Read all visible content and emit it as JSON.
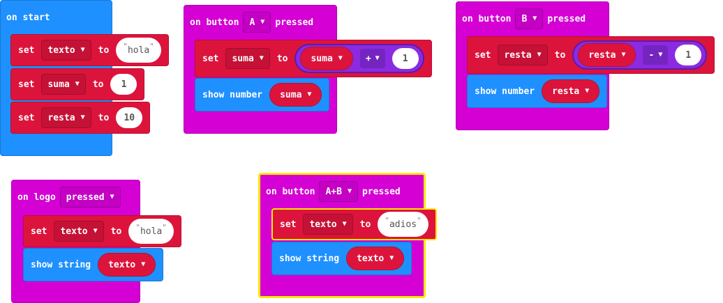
{
  "on_start": {
    "title": "on start",
    "set_label": "set",
    "to_label": "to",
    "rows": [
      {
        "var": "texto",
        "value": "hola"
      },
      {
        "var": "suma",
        "value": "1"
      },
      {
        "var": "resta",
        "value": "10"
      }
    ]
  },
  "button_a": {
    "on_button": "on button",
    "button": "A",
    "pressed": "pressed",
    "set_label": "set",
    "var": "suma",
    "to_label": "to",
    "operand_var": "suma",
    "operator": "+",
    "operand_value": "1",
    "show_label": "show number",
    "show_var": "suma"
  },
  "button_b": {
    "on_button": "on button",
    "button": "B",
    "pressed": "pressed",
    "set_label": "set",
    "var": "resta",
    "to_label": "to",
    "operand_var": "resta",
    "operator": "-",
    "operand_value": "1",
    "show_label": "show number",
    "show_var": "resta"
  },
  "logo": {
    "on_logo": "on logo",
    "gesture": "pressed",
    "set_label": "set",
    "var": "texto",
    "to_label": "to",
    "value": "hola",
    "show_label": "show string",
    "show_var": "texto"
  },
  "button_ab": {
    "on_button": "on button",
    "button": "A+B",
    "pressed": "pressed",
    "set_label": "set",
    "var": "texto",
    "to_label": "to",
    "value": "adios",
    "show_label": "show string",
    "show_var": "texto"
  },
  "colors": {
    "event_blue": "#1e90ff",
    "input_magenta": "#d400d4",
    "variables_red": "#dc143c",
    "math_purple": "#8a2be2",
    "selected_outline": "#ffe600"
  },
  "icons": {
    "dropdown": "caret-down-icon"
  }
}
